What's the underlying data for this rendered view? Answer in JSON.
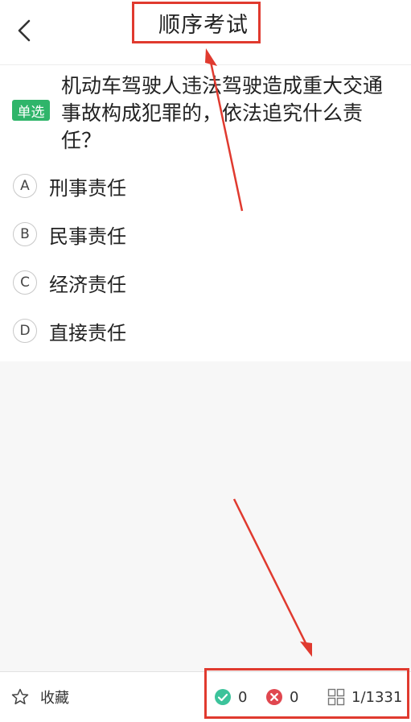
{
  "header": {
    "title": "顺序考试"
  },
  "question": {
    "type_badge": "单选",
    "text": "机动车驾驶人违法驾驶造成重大交通事故构成犯罪的，依法追究什么责任？",
    "options": [
      {
        "letter": "A",
        "text": "刑事责任"
      },
      {
        "letter": "B",
        "text": "民事责任"
      },
      {
        "letter": "C",
        "text": "经济责任"
      },
      {
        "letter": "D",
        "text": "直接责任"
      }
    ]
  },
  "bottom": {
    "favorite_label": "收藏",
    "correct_count": "0",
    "wrong_count": "0",
    "progress": "1/1331"
  },
  "colors": {
    "accent_red": "#e03a2f",
    "badge_green": "#2fb56a",
    "correct_teal": "#3cc39b",
    "wrong_red": "#e0474f"
  }
}
